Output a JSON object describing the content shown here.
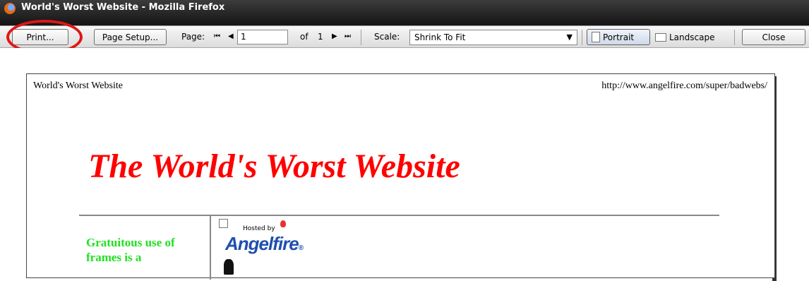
{
  "window": {
    "title": "World's Worst Website - Mozilla Firefox"
  },
  "toolbar": {
    "print_label": "Print...",
    "page_setup_label": "Page Setup...",
    "page_label": "Page:",
    "first_page_glyph": "⏮",
    "prev_page_glyph": "◀",
    "page_value": "1",
    "of_label": "of",
    "total_pages": "1",
    "next_page_glyph": "▶",
    "last_page_glyph": "⏭",
    "scale_label": "Scale:",
    "scale_value": "Shrink To Fit",
    "portrait_label": "Portrait",
    "landscape_label": "Landscape",
    "close_label": "Close"
  },
  "annotation": {
    "highlight_color": "#e01515",
    "target": "print-button"
  },
  "page": {
    "header_left": "World's Worst Website",
    "header_right": "http://www.angelfire.com/super/badwebs/",
    "title": "The World's Worst Website",
    "title_color": "#ff0000",
    "sidebar_text": "Gratuitous use of frames is a",
    "sidebar_color": "#22e022",
    "hosted_by": "Hosted by",
    "brand": "Angelfire",
    "brand_mark": "®"
  }
}
